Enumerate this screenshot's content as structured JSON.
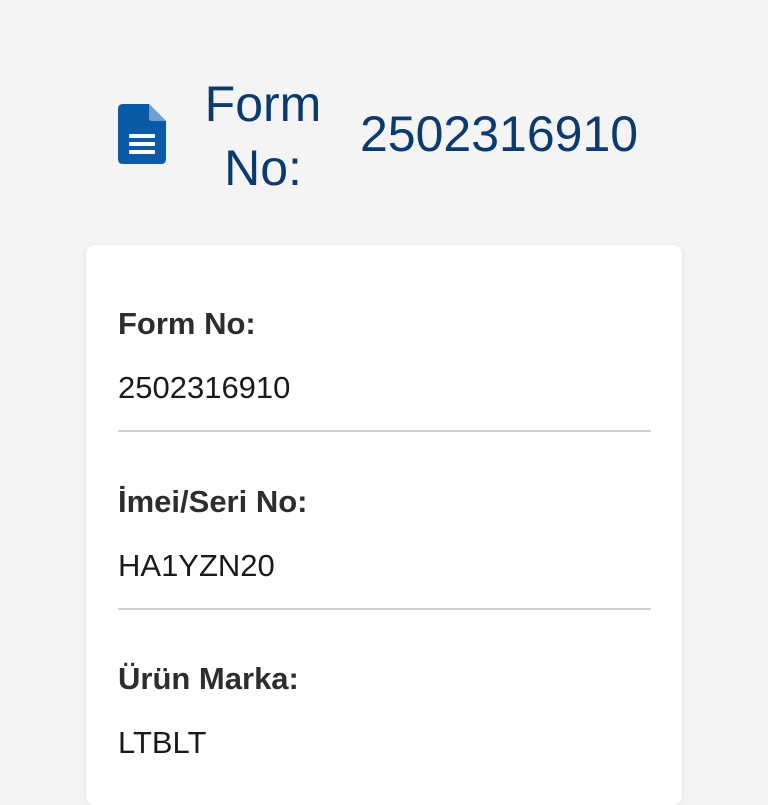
{
  "header": {
    "icon": "document-icon",
    "label": "Form No:",
    "value": "2502316910"
  },
  "details": {
    "fields": [
      {
        "label": "Form No:",
        "value": "2502316910"
      },
      {
        "label": "İmei/Seri No:",
        "value": "HA1YZN20"
      },
      {
        "label": "Ürün Marka:",
        "value": "LTBLT"
      }
    ]
  },
  "colors": {
    "background": "#f4f4f5",
    "accent": "#0b5aa8",
    "header_text": "#0b3a6e",
    "card": "#ffffff",
    "divider": "#cfcfd3"
  }
}
